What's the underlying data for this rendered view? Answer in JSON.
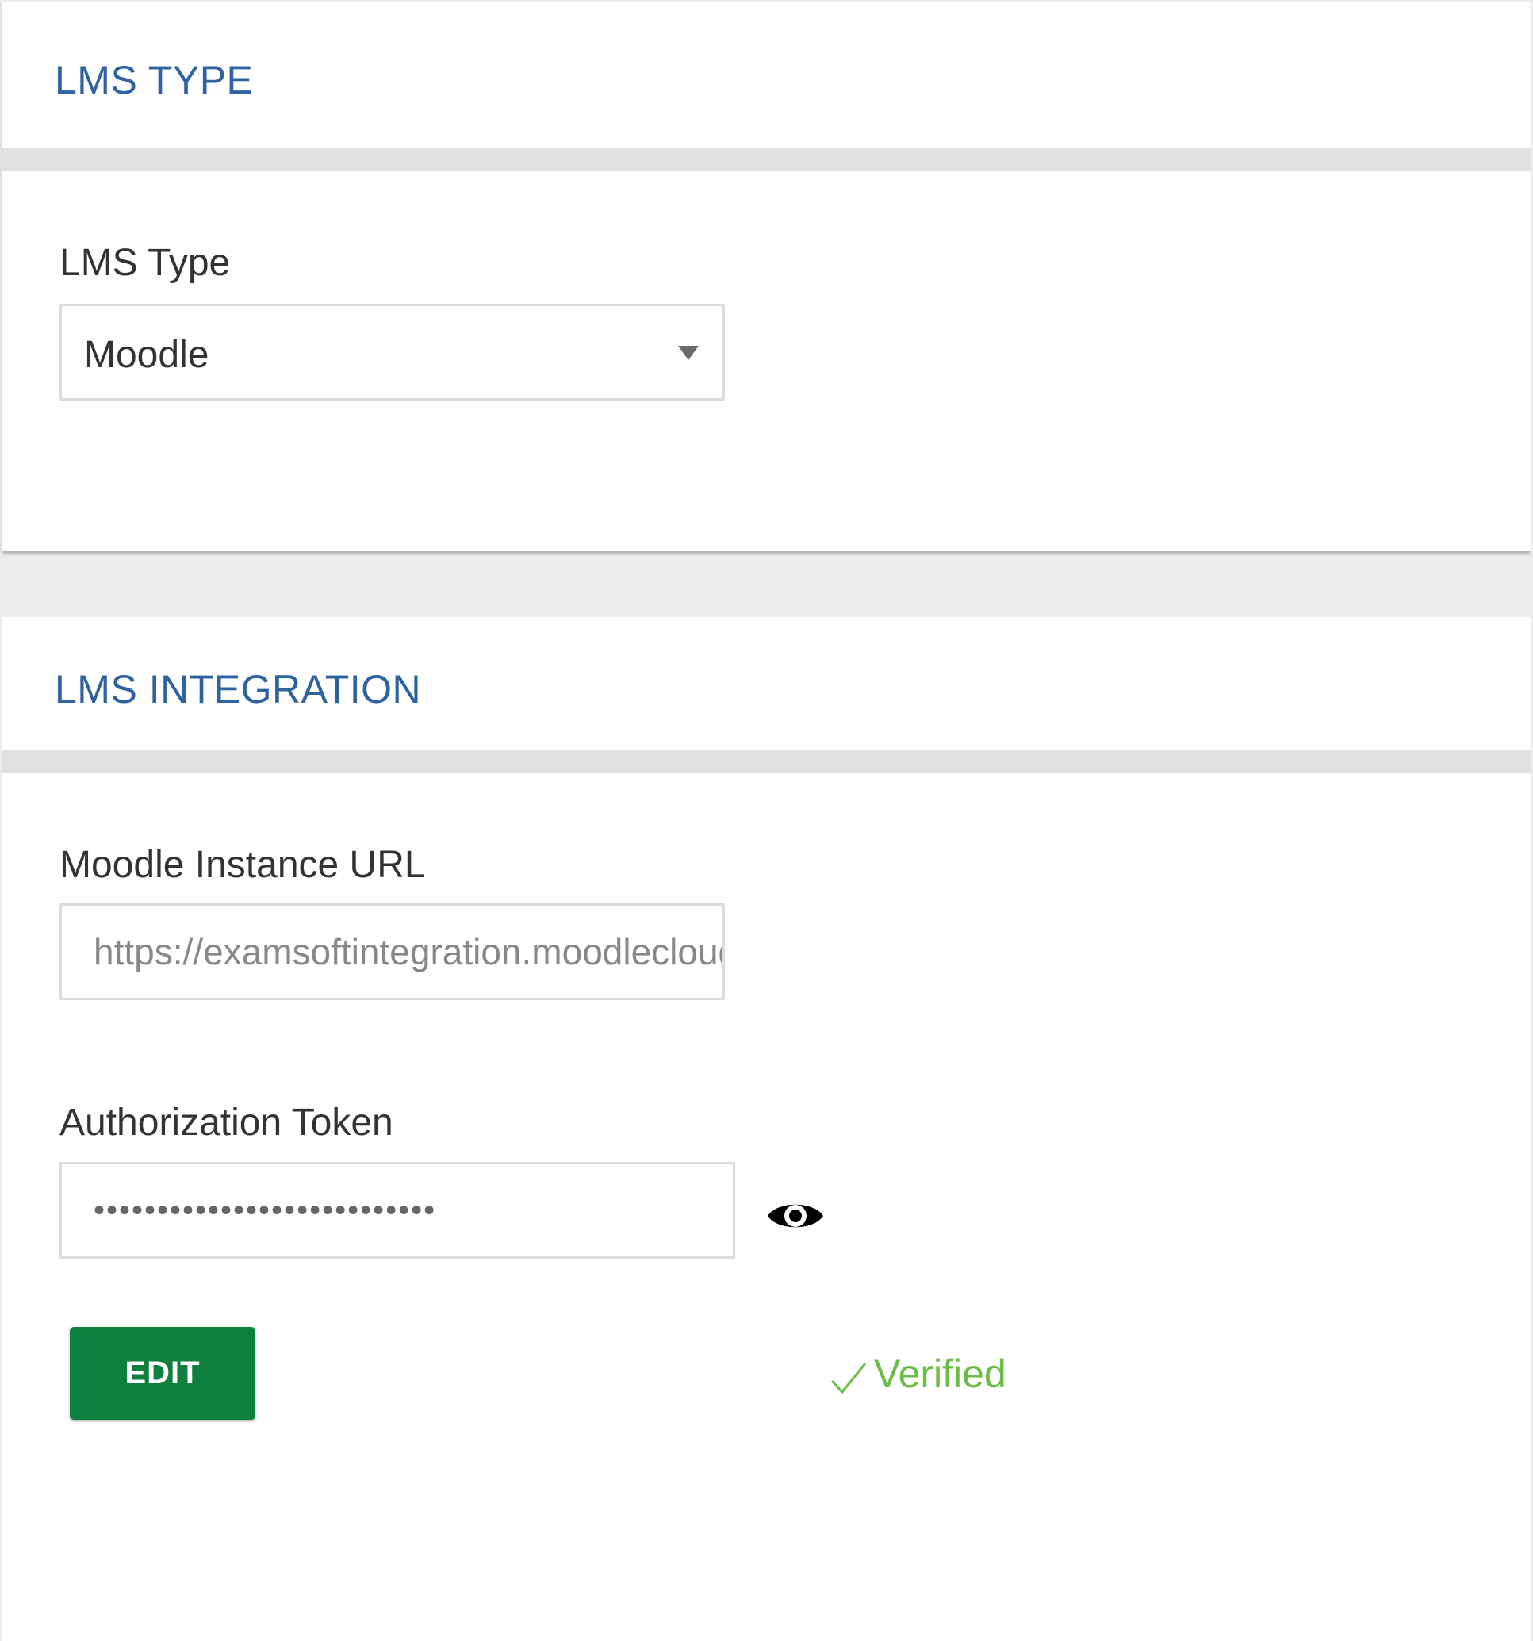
{
  "lms_type_card": {
    "title": "LMS TYPE",
    "field_label": "LMS Type",
    "selected_value": "Moodle"
  },
  "lms_integration_card": {
    "title": "LMS INTEGRATION",
    "url_label": "Moodle Instance URL",
    "url_value": "https://examsoftintegration.moodlecloud.com",
    "token_label": "Authorization Token",
    "token_masked": "•••••••••••••••••••••••••••",
    "edit_label": "EDIT",
    "status_text": "Verified"
  },
  "icons": {
    "show_password": "eye-icon",
    "dropdown": "chevron-down-icon",
    "status": "checkmark-icon"
  },
  "colors": {
    "title": "#2f62a0",
    "edit_button": "#0d803e",
    "verified": "#6cbd45",
    "divider": "#e1e1e1",
    "background": "#ececec"
  }
}
